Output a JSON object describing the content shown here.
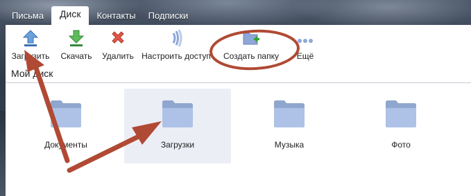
{
  "tabs": [
    {
      "label": "Письма"
    },
    {
      "label": "Диск",
      "active": true
    },
    {
      "label": "Контакты"
    },
    {
      "label": "Подписки"
    }
  ],
  "toolbar": {
    "upload": {
      "label": "Загрузить",
      "icon": "upload-arrow-icon"
    },
    "download": {
      "label": "Скачать",
      "icon": "download-arrow-icon"
    },
    "delete": {
      "label": "Удалить",
      "icon": "delete-x-icon"
    },
    "share": {
      "label": "Настроить доступ",
      "icon": "share-access-icon"
    },
    "new_folder": {
      "label": "Создать папку",
      "icon": "new-folder-icon"
    },
    "more": {
      "label": "Ещё",
      "icon": "more-dots-icon"
    }
  },
  "section_title": "Мой диск",
  "folders": [
    {
      "name": "Документы",
      "selected": false
    },
    {
      "name": "Загрузки",
      "selected": true
    },
    {
      "name": "Музыка",
      "selected": false
    },
    {
      "name": "Фото",
      "selected": false
    }
  ],
  "colors": {
    "annotation": "#b04a34",
    "folder": "#a9bde0",
    "selection": "#eceef6"
  }
}
